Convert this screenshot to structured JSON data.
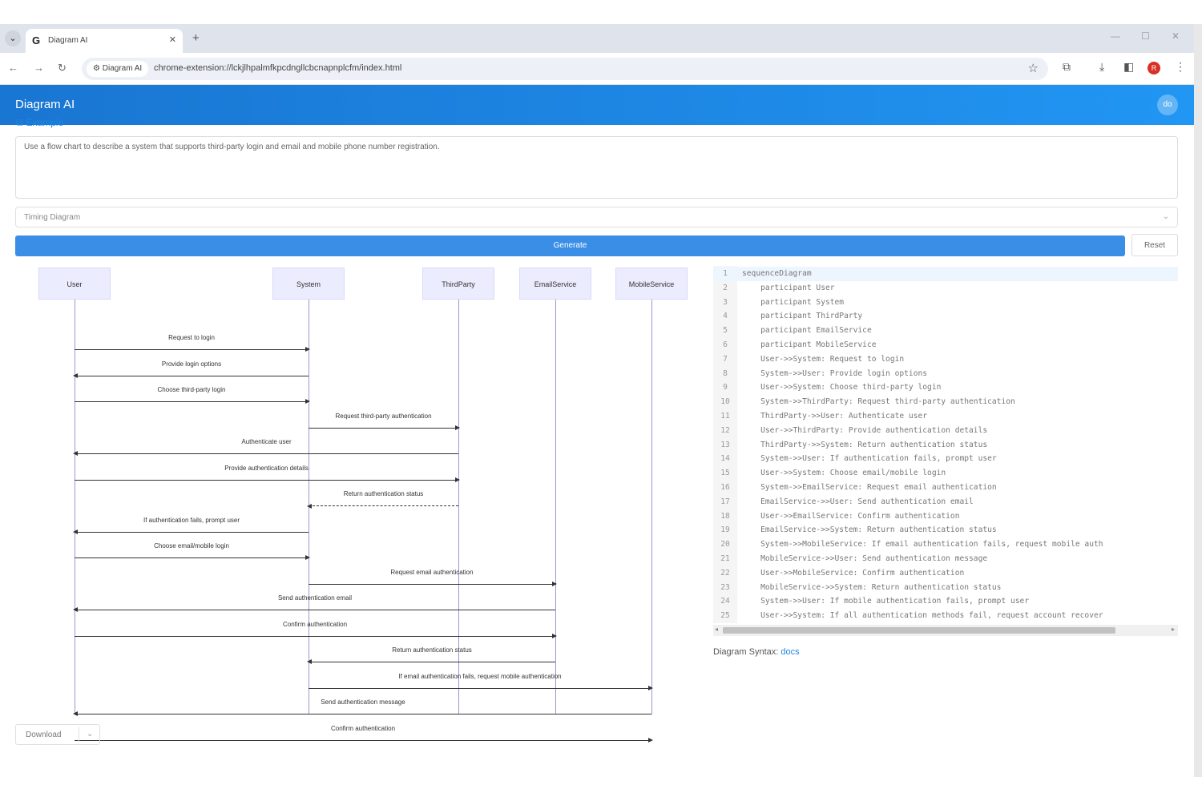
{
  "browser": {
    "tab_title": "Diagram AI",
    "tab_favicon": "G",
    "site_chip": "Diagram AI",
    "url": "chrome-extension://lckjlhpalmfkpcdngllcbcnapnplcfm/index.html",
    "profile_initial": "R"
  },
  "app": {
    "title": "Diagram AI",
    "avatar": "do"
  },
  "form": {
    "example_label": "Example",
    "prompt_text": "Use a flow chart to describe a system that supports third-party login and email and mobile phone number registration.",
    "diagram_type": "Timing Diagram",
    "generate_label": "Generate",
    "reset_label": "Reset"
  },
  "diagram": {
    "participants": [
      "User",
      "System",
      "ThirdParty",
      "EmailService",
      "MobileService"
    ],
    "messages": [
      {
        "from": 0,
        "to": 1,
        "label": "Request to login",
        "style": "solid"
      },
      {
        "from": 1,
        "to": 0,
        "label": "Provide login options",
        "style": "solid"
      },
      {
        "from": 0,
        "to": 1,
        "label": "Choose third-party login",
        "style": "solid"
      },
      {
        "from": 1,
        "to": 2,
        "label": "Request third-party authentication",
        "style": "solid"
      },
      {
        "from": 2,
        "to": 0,
        "label": "Authenticate user",
        "style": "solid"
      },
      {
        "from": 0,
        "to": 2,
        "label": "Provide authentication details",
        "style": "solid"
      },
      {
        "from": 2,
        "to": 1,
        "label": "Return authentication status",
        "style": "dashed"
      },
      {
        "from": 1,
        "to": 0,
        "label": "If authentication fails, prompt user",
        "style": "solid"
      },
      {
        "from": 0,
        "to": 1,
        "label": "Choose email/mobile login",
        "style": "solid"
      },
      {
        "from": 1,
        "to": 3,
        "label": "Request email authentication",
        "style": "solid"
      },
      {
        "from": 3,
        "to": 0,
        "label": "Send authentication email",
        "style": "solid"
      },
      {
        "from": 0,
        "to": 3,
        "label": "Confirm authentication",
        "style": "solid"
      },
      {
        "from": 3,
        "to": 1,
        "label": "Return authentication status",
        "style": "solid"
      },
      {
        "from": 1,
        "to": 4,
        "label": "If email authentication fails, request mobile authentication",
        "style": "solid"
      },
      {
        "from": 4,
        "to": 0,
        "label": "Send authentication message",
        "style": "solid"
      },
      {
        "from": 0,
        "to": 4,
        "label": "Confirm authentication",
        "style": "solid"
      }
    ]
  },
  "editor": {
    "lines": [
      "sequenceDiagram",
      "    participant User",
      "    participant System",
      "    participant ThirdParty",
      "    participant EmailService",
      "    participant MobileService",
      "    User->>System: Request to login",
      "    System->>User: Provide login options",
      "    User->>System: Choose third-party login",
      "    System->>ThirdParty: Request third-party authentication",
      "    ThirdParty->>User: Authenticate user",
      "    User->>ThirdParty: Provide authentication details",
      "    ThirdParty->>System: Return authentication status",
      "    System->>User: If authentication fails, prompt user",
      "    User->>System: Choose email/mobile login",
      "    System->>EmailService: Request email authentication",
      "    EmailService->>User: Send authentication email",
      "    User->>EmailService: Confirm authentication",
      "    EmailService->>System: Return authentication status",
      "    System->>MobileService: If email authentication fails, request mobile auth",
      "    MobileService->>User: Send authentication message",
      "    User->>MobileService: Confirm authentication",
      "    MobileService->>System: Return authentication status",
      "    System->>User: If mobile authentication fails, prompt user",
      "    User->>System: If all authentication methods fail, request account recover"
    ]
  },
  "footer": {
    "syntax_label": "Diagram Syntax:",
    "docs_link": "docs",
    "download_label": "Download"
  }
}
